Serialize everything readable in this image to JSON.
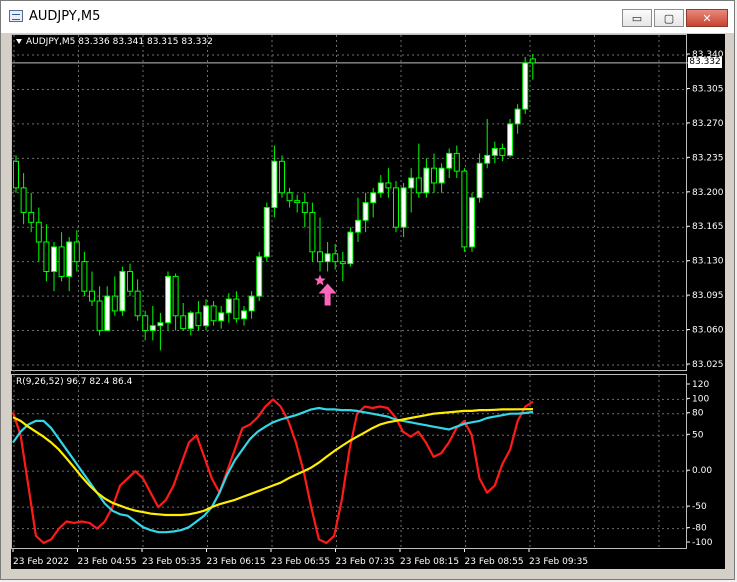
{
  "window": {
    "title": "AUDJPY,M5",
    "minimize_glyph": "▭",
    "maximize_glyph": "▢",
    "close_glyph": "✕"
  },
  "price_pane": {
    "label": "AUDJPY,M5  83.336 83.341 83.315 83.332",
    "current_price": "83.332",
    "y_ticks": [
      "83.340",
      "83.305",
      "83.270",
      "83.235",
      "83.200",
      "83.165",
      "83.130",
      "83.095",
      "83.060",
      "83.025"
    ],
    "y_min": 83.025,
    "y_max": 83.34,
    "colors": {
      "up": "#ffffff",
      "down": "#ffffff",
      "wick": "#00ff00",
      "grid": "#6e6e6e",
      "star": "#ff66bb",
      "arrow": "#ff66bb"
    }
  },
  "indicator_pane": {
    "label": "R(9,26,52) 96.7 82.4 86.4",
    "y_ticks": [
      "120",
      "100",
      "80",
      "50",
      "0.00",
      "-50",
      "-80",
      "-100"
    ],
    "y_min": -100,
    "y_max": 120,
    "series_colors": {
      "fast": "#ff1a1a",
      "mid": "#33d6e6",
      "slow": "#ffee00"
    }
  },
  "time_axis": {
    "labels": [
      "23 Feb 2022",
      "23 Feb 04:55",
      "23 Feb 05:35",
      "23 Feb 06:15",
      "23 Feb 06:55",
      "23 Feb 07:35",
      "23 Feb 08:15",
      "23 Feb 08:55",
      "23 Feb 09:35"
    ]
  },
  "chart_data": {
    "type": "candlestick",
    "title": "AUDJPY,M5",
    "candles": [
      {
        "o": 83.232,
        "h": 83.238,
        "l": 83.2,
        "c": 83.205
      },
      {
        "o": 83.205,
        "h": 83.22,
        "l": 83.168,
        "c": 83.18
      },
      {
        "o": 83.18,
        "h": 83.2,
        "l": 83.16,
        "c": 83.17
      },
      {
        "o": 83.17,
        "h": 83.185,
        "l": 83.13,
        "c": 83.15
      },
      {
        "o": 83.15,
        "h": 83.168,
        "l": 83.11,
        "c": 83.12
      },
      {
        "o": 83.12,
        "h": 83.15,
        "l": 83.1,
        "c": 83.145
      },
      {
        "o": 83.145,
        "h": 83.16,
        "l": 83.11,
        "c": 83.115
      },
      {
        "o": 83.115,
        "h": 83.155,
        "l": 83.1,
        "c": 83.15
      },
      {
        "o": 83.15,
        "h": 83.162,
        "l": 83.12,
        "c": 83.13
      },
      {
        "o": 83.13,
        "h": 83.14,
        "l": 83.095,
        "c": 83.1
      },
      {
        "o": 83.1,
        "h": 83.12,
        "l": 83.085,
        "c": 83.09
      },
      {
        "o": 83.09,
        "h": 83.105,
        "l": 83.055,
        "c": 83.06
      },
      {
        "o": 83.06,
        "h": 83.105,
        "l": 83.06,
        "c": 83.095
      },
      {
        "o": 83.095,
        "h": 83.115,
        "l": 83.075,
        "c": 83.08
      },
      {
        "o": 83.08,
        "h": 83.125,
        "l": 83.075,
        "c": 83.12
      },
      {
        "o": 83.12,
        "h": 83.128,
        "l": 83.095,
        "c": 83.1
      },
      {
        "o": 83.1,
        "h": 83.112,
        "l": 83.07,
        "c": 83.075
      },
      {
        "o": 83.075,
        "h": 83.08,
        "l": 83.05,
        "c": 83.06
      },
      {
        "o": 83.06,
        "h": 83.085,
        "l": 83.05,
        "c": 83.065
      },
      {
        "o": 83.065,
        "h": 83.078,
        "l": 83.04,
        "c": 83.068
      },
      {
        "o": 83.068,
        "h": 83.12,
        "l": 83.06,
        "c": 83.115
      },
      {
        "o": 83.115,
        "h": 83.118,
        "l": 83.06,
        "c": 83.075
      },
      {
        "o": 83.075,
        "h": 83.088,
        "l": 83.06,
        "c": 83.062
      },
      {
        "o": 83.062,
        "h": 83.08,
        "l": 83.055,
        "c": 83.078
      },
      {
        "o": 83.078,
        "h": 83.09,
        "l": 83.06,
        "c": 83.065
      },
      {
        "o": 83.065,
        "h": 83.092,
        "l": 83.06,
        "c": 83.085
      },
      {
        "o": 83.085,
        "h": 83.09,
        "l": 83.065,
        "c": 83.07
      },
      {
        "o": 83.07,
        "h": 83.085,
        "l": 83.062,
        "c": 83.078
      },
      {
        "o": 83.078,
        "h": 83.098,
        "l": 83.068,
        "c": 83.092
      },
      {
        "o": 83.092,
        "h": 83.1,
        "l": 83.068,
        "c": 83.072
      },
      {
        "o": 83.072,
        "h": 83.085,
        "l": 83.065,
        "c": 83.08
      },
      {
        "o": 83.08,
        "h": 83.1,
        "l": 83.072,
        "c": 83.095
      },
      {
        "o": 83.095,
        "h": 83.14,
        "l": 83.09,
        "c": 83.135
      },
      {
        "o": 83.135,
        "h": 83.19,
        "l": 83.13,
        "c": 83.185
      },
      {
        "o": 83.185,
        "h": 83.248,
        "l": 83.175,
        "c": 83.232
      },
      {
        "o": 83.232,
        "h": 83.238,
        "l": 83.195,
        "c": 83.2
      },
      {
        "o": 83.2,
        "h": 83.205,
        "l": 83.185,
        "c": 83.192
      },
      {
        "o": 83.192,
        "h": 83.198,
        "l": 83.18,
        "c": 83.19
      },
      {
        "o": 83.19,
        "h": 83.2,
        "l": 83.165,
        "c": 83.18
      },
      {
        "o": 83.18,
        "h": 83.19,
        "l": 83.13,
        "c": 83.14
      },
      {
        "o": 83.14,
        "h": 83.175,
        "l": 83.12,
        "c": 83.13
      },
      {
        "o": 83.13,
        "h": 83.15,
        "l": 83.12,
        "c": 83.138
      },
      {
        "o": 83.138,
        "h": 83.148,
        "l": 83.122,
        "c": 83.13
      },
      {
        "o": 83.13,
        "h": 83.14,
        "l": 83.11,
        "c": 83.128
      },
      {
        "o": 83.128,
        "h": 83.165,
        "l": 83.125,
        "c": 83.16
      },
      {
        "o": 83.16,
        "h": 83.195,
        "l": 83.15,
        "c": 83.172
      },
      {
        "o": 83.172,
        "h": 83.2,
        "l": 83.16,
        "c": 83.19
      },
      {
        "o": 83.19,
        "h": 83.205,
        "l": 83.175,
        "c": 83.2
      },
      {
        "o": 83.2,
        "h": 83.218,
        "l": 83.195,
        "c": 83.21
      },
      {
        "o": 83.21,
        "h": 83.225,
        "l": 83.195,
        "c": 83.205
      },
      {
        "o": 83.205,
        "h": 83.212,
        "l": 83.16,
        "c": 83.165
      },
      {
        "o": 83.165,
        "h": 83.21,
        "l": 83.155,
        "c": 83.205
      },
      {
        "o": 83.205,
        "h": 83.225,
        "l": 83.18,
        "c": 83.215
      },
      {
        "o": 83.215,
        "h": 83.25,
        "l": 83.195,
        "c": 83.2
      },
      {
        "o": 83.2,
        "h": 83.235,
        "l": 83.195,
        "c": 83.225
      },
      {
        "o": 83.225,
        "h": 83.24,
        "l": 83.2,
        "c": 83.21
      },
      {
        "o": 83.21,
        "h": 83.23,
        "l": 83.2,
        "c": 83.225
      },
      {
        "o": 83.225,
        "h": 83.245,
        "l": 83.215,
        "c": 83.24
      },
      {
        "o": 83.24,
        "h": 83.248,
        "l": 83.215,
        "c": 83.222
      },
      {
        "o": 83.222,
        "h": 83.225,
        "l": 83.14,
        "c": 83.145
      },
      {
        "o": 83.145,
        "h": 83.2,
        "l": 83.14,
        "c": 83.195
      },
      {
        "o": 83.195,
        "h": 83.24,
        "l": 83.19,
        "c": 83.23
      },
      {
        "o": 83.23,
        "h": 83.275,
        "l": 83.225,
        "c": 83.238
      },
      {
        "o": 83.238,
        "h": 83.252,
        "l": 83.23,
        "c": 83.245
      },
      {
        "o": 83.245,
        "h": 83.25,
        "l": 83.232,
        "c": 83.238
      },
      {
        "o": 83.238,
        "h": 83.275,
        "l": 83.236,
        "c": 83.27
      },
      {
        "o": 83.27,
        "h": 83.29,
        "l": 83.26,
        "c": 83.285
      },
      {
        "o": 83.285,
        "h": 83.338,
        "l": 83.28,
        "c": 83.332
      },
      {
        "o": 83.336,
        "h": 83.341,
        "l": 83.315,
        "c": 83.332
      }
    ],
    "y_range": [
      83.025,
      83.34
    ],
    "markers": [
      {
        "type": "star",
        "index": 40
      },
      {
        "type": "up-arrow",
        "index": 41
      }
    ],
    "indicator": {
      "name": "R(9,26,52)",
      "last_values": [
        96.7,
        82.4,
        86.4
      ],
      "y_range": [
        -100,
        120
      ],
      "series": [
        {
          "values": [
            82,
            50,
            -20,
            -90,
            -100,
            -95,
            -80,
            -70,
            -72,
            -70,
            -72,
            -80,
            -70,
            -50,
            -20,
            -10,
            0,
            -10,
            -30,
            -50,
            -40,
            -20,
            10,
            40,
            50,
            20,
            -10,
            -30,
            0,
            30,
            60,
            65,
            75,
            90,
            100,
            90,
            70,
            40,
            0,
            -50,
            -95,
            -100,
            -90,
            -40,
            30,
            80,
            90,
            88,
            90,
            88,
            75,
            55,
            48,
            55,
            40,
            20,
            25,
            40,
            60,
            70,
            50,
            -10,
            -30,
            -20,
            10,
            30,
            70,
            90,
            96.7
          ]
        },
        {
          "values": [
            40,
            55,
            65,
            70,
            70,
            60,
            45,
            30,
            15,
            0,
            -15,
            -30,
            -45,
            -55,
            -60,
            -62,
            -70,
            -78,
            -82,
            -85,
            -85,
            -84,
            -82,
            -78,
            -70,
            -62,
            -50,
            -30,
            -5,
            15,
            30,
            45,
            55,
            62,
            68,
            72,
            75,
            78,
            82,
            86,
            88,
            86,
            86,
            85,
            85,
            84,
            82,
            80,
            78,
            76,
            72,
            70,
            68,
            66,
            64,
            62,
            60,
            58,
            62,
            66,
            68,
            70,
            74,
            76,
            78,
            80,
            80,
            81,
            82.4
          ]
        },
        {
          "values": [
            75,
            70,
            62,
            55,
            48,
            40,
            30,
            18,
            5,
            -8,
            -20,
            -30,
            -38,
            -44,
            -48,
            -52,
            -55,
            -57,
            -59,
            -60,
            -61,
            -61,
            -61,
            -60,
            -58,
            -55,
            -50,
            -46,
            -43,
            -40,
            -36,
            -32,
            -28,
            -24,
            -20,
            -16,
            -10,
            -5,
            0,
            5,
            12,
            20,
            28,
            35,
            42,
            48,
            54,
            60,
            65,
            68,
            70,
            72,
            74,
            76,
            78,
            80,
            81,
            82,
            83,
            84,
            84,
            85,
            85,
            85.5,
            86,
            86,
            86.2,
            86.3,
            86.4
          ]
        }
      ]
    }
  }
}
